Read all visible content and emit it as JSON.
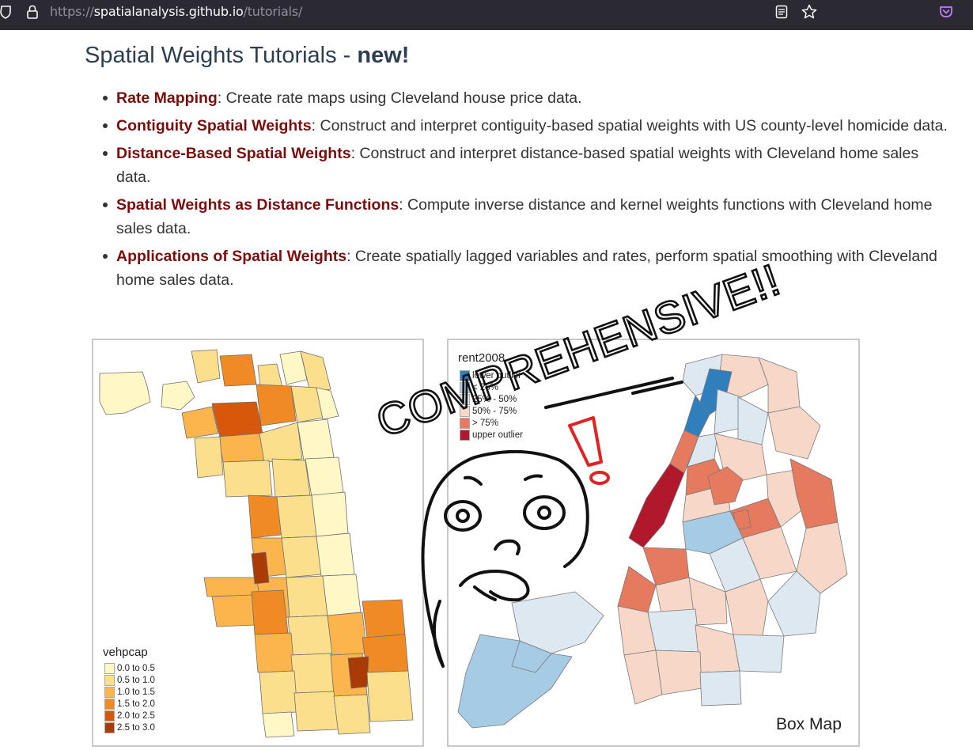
{
  "browser": {
    "url_prefix": "https://",
    "url_host": "spatialanalysis.github.io",
    "url_path": "/tutorials/",
    "icons": [
      "shield-icon",
      "lock-icon",
      "reader-mode-icon",
      "bookmark-star-icon",
      "pocket-icon"
    ]
  },
  "page": {
    "title": "Spatial Weights Tutorials - ",
    "title_emphasis": "new!",
    "tutorials": [
      {
        "link": "Rate Mapping",
        "desc": ": Create rate maps using Cleveland house price data."
      },
      {
        "link": "Contiguity Spatial Weights",
        "desc": ": Construct and interpret contiguity-based spatial weights with US county-level homicide data."
      },
      {
        "link": "Distance-Based Spatial Weights",
        "desc": ": Construct and interpret distance-based spatial weights with Cleveland home sales data."
      },
      {
        "link": "Spatial Weights as Distance Functions",
        "desc": ": Compute inverse distance and kernel weights functions with Cleveland home sales data."
      },
      {
        "link": "Applications of Spatial Weights",
        "desc": ": Create spatially lagged variables and rates, perform spatial smoothing with Cleveland home sales data."
      }
    ]
  },
  "left_map": {
    "legend_title": "vehpcap",
    "legend": [
      {
        "label": "0.0 to 0.5",
        "color": "#fff7c6"
      },
      {
        "label": "0.5 to 1.0",
        "color": "#fbdf8c"
      },
      {
        "label": "1.0 to 1.5",
        "color": "#fbb54c"
      },
      {
        "label": "1.5 to 2.0",
        "color": "#ef8a25"
      },
      {
        "label": "2.0 to 2.5",
        "color": "#d8580b"
      },
      {
        "label": "2.5 to 3.0",
        "color": "#a83b06"
      }
    ]
  },
  "right_map": {
    "legend_title": "rent2008",
    "legend": [
      {
        "label": "lower outlier",
        "color": "#2f7fbd"
      },
      {
        "label": "< 25%",
        "color": "#a6cbe4"
      },
      {
        "label": "25% - 50%",
        "color": "#dde8f1"
      },
      {
        "label": "50% - 75%",
        "color": "#f7d8c8"
      },
      {
        "label": "> 75%",
        "color": "#e57a5f"
      },
      {
        "label": "upper outlier",
        "color": "#b2182b"
      }
    ],
    "caption": "Box Map"
  },
  "annotation": {
    "text": "COMPREHENSIVE!!",
    "exclamation_color": "#e32222"
  }
}
